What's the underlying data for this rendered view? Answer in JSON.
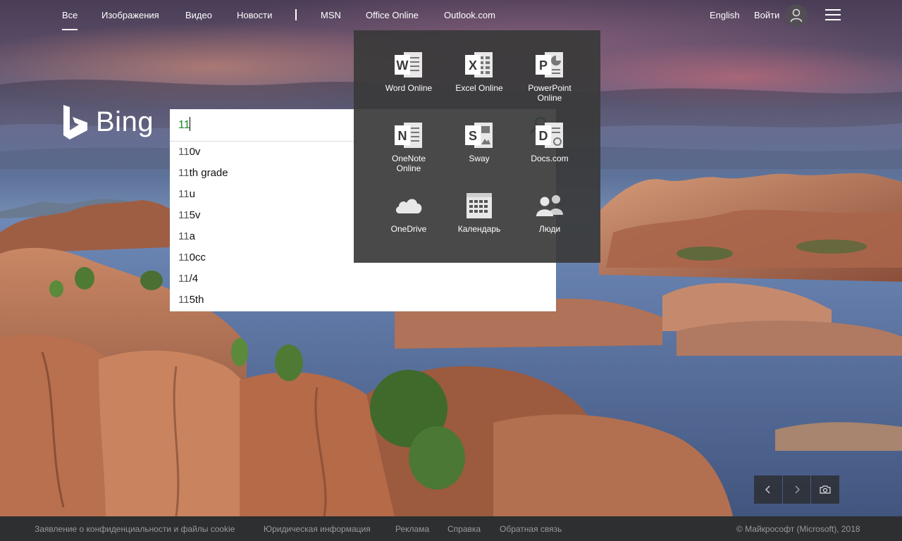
{
  "nav": {
    "all": "Все",
    "images": "Изображения",
    "video": "Видео",
    "news": "Новости",
    "msn": "MSN",
    "office": "Office Online",
    "outlook": "Outlook.com",
    "language": "English",
    "signin": "Войти"
  },
  "logo": {
    "text": "Bing"
  },
  "search": {
    "value": "11",
    "suggestions": [
      {
        "typed": "11",
        "rest": "0v"
      },
      {
        "typed": "11",
        "rest": "th grade"
      },
      {
        "typed": "11",
        "rest": "u"
      },
      {
        "typed": "11",
        "rest": "5v"
      },
      {
        "typed": "11",
        "rest": "a"
      },
      {
        "typed": "11",
        "rest": "0cc"
      },
      {
        "typed": "11",
        "rest": "/4"
      },
      {
        "typed": "11",
        "rest": "5th"
      }
    ]
  },
  "apps": {
    "word": "Word Online",
    "excel": "Excel Online",
    "powerpoint_1": "PowerPoint",
    "powerpoint_2": "Online",
    "onenote_1": "OneNote",
    "onenote_2": "Online",
    "sway": "Sway",
    "docs": "Docs.com",
    "onedrive": "OneDrive",
    "calendar": "Календарь",
    "people": "Люди",
    "letters": {
      "word": "W",
      "excel": "X",
      "powerpoint": "P",
      "onenote": "N",
      "sway": "S",
      "docs": "D"
    }
  },
  "footer": {
    "privacy": "Заявление о конфиденциальности и файлы cookie",
    "legal": "Юридическая информация",
    "ads": "Реклама",
    "help": "Справка",
    "feedback": "Обратная связь",
    "copyright": "© Майкрософт (Microsoft), 2018"
  },
  "icons": {
    "hamburger": "menu-icon",
    "avatar": "user-icon",
    "search": "search-icon",
    "prev": "chevron-left-icon",
    "next": "chevron-right-icon",
    "camera": "camera-icon"
  },
  "colors": {
    "query_text": "#1a8a2a",
    "apps_panel": "#3a3a3a",
    "footer_bg": "#2d2d2d"
  }
}
